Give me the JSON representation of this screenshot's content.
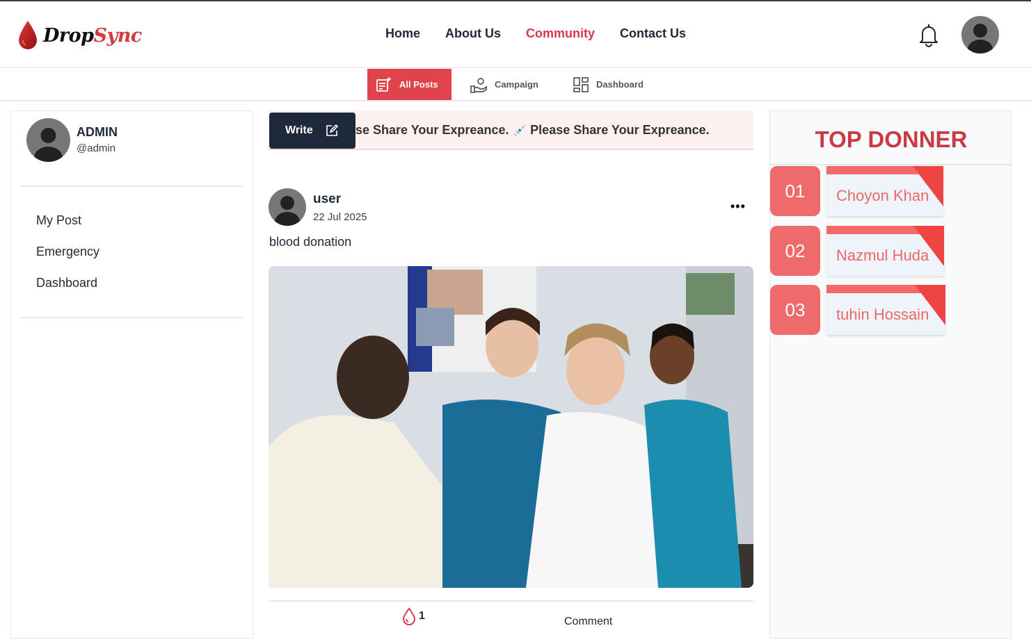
{
  "brand": {
    "part1": "Drop",
    "part2": "Sync"
  },
  "nav": {
    "items": [
      "Home",
      "About Us",
      "Community",
      "Contact Us"
    ],
    "active": "Community"
  },
  "subnav": {
    "all_posts": "All Posts",
    "campaign": "Campaign",
    "dashboard": "Dashboard"
  },
  "profile": {
    "name": "ADMIN",
    "handle": "@admin"
  },
  "sidebar": {
    "links": [
      "My Post",
      "Emergency",
      "Dashboard"
    ]
  },
  "composer": {
    "write_label": "Write",
    "marquee_a": "lease Share Your Expreance.",
    "marquee_b": "Please Share Your Expreance."
  },
  "post": {
    "user": "user",
    "date": "22 Jul 2025",
    "text": "blood donation",
    "likes": "1",
    "comment_label": "Comment",
    "menu": "•••"
  },
  "top_donors": {
    "title": "TOP DONNER",
    "list": [
      {
        "rank": "01",
        "name": "Choyon Khan"
      },
      {
        "rank": "02",
        "name": "Nazmul Huda"
      },
      {
        "rank": "03",
        "name": "tuhin Hossain"
      }
    ]
  },
  "colors": {
    "accent": "#e0434b",
    "brand_red": "#d63a3a",
    "dark": "#1e293b"
  }
}
